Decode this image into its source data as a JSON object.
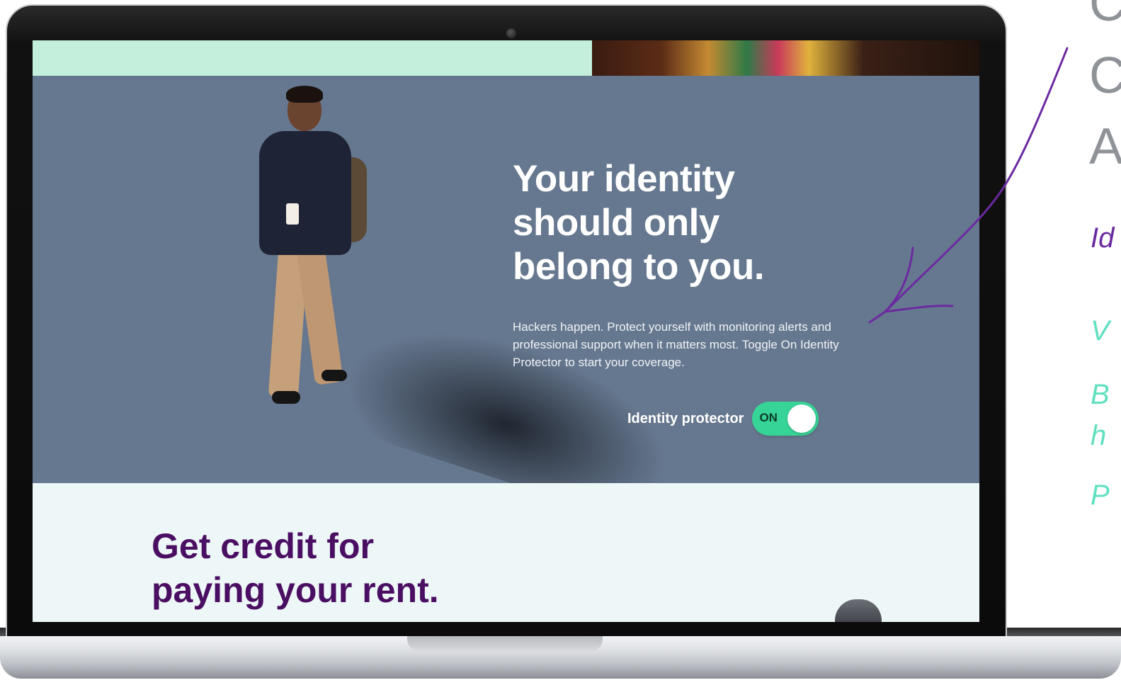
{
  "hero": {
    "headline_lines": [
      "Your identity",
      "should only",
      "belong to you."
    ],
    "body": "Hackers happen. Protect yourself with monitoring alerts and professional support when it matters most. Toggle On Identity Protector to start your coverage.",
    "toggle_label": "Identity protector",
    "toggle_state": "ON"
  },
  "section2": {
    "title_lines": [
      "Get credit for",
      "paying your rent."
    ]
  },
  "right_annotations": {
    "gray_letters": [
      "C",
      "C",
      "A"
    ],
    "purple_text": "Id",
    "green_letters": [
      "V",
      "B",
      "h",
      "P"
    ]
  },
  "colors": {
    "hero_bg": "#66788f",
    "mint_strip": "#c3efdc",
    "toggle_on": "#37d497",
    "credit_title": "#4a0f62",
    "annotation_purple": "#6b2aa0",
    "annotation_green": "#5fe0bf"
  },
  "icons": {
    "laptop_camera": "camera-dot",
    "annotation_arrow": "hand-drawn-arrow"
  }
}
